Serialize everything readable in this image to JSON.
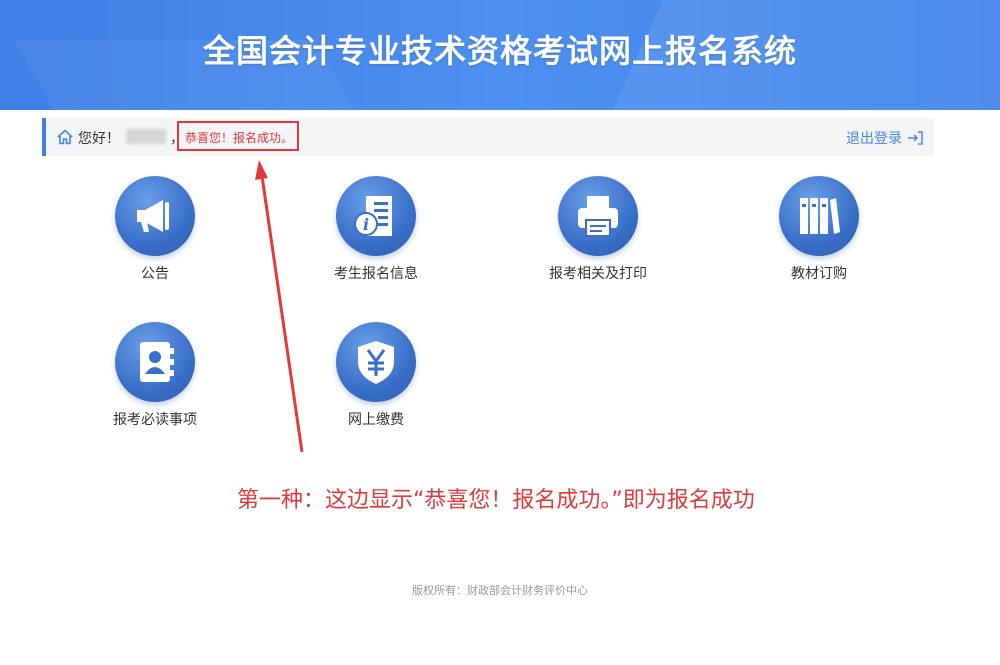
{
  "header": {
    "title": "全国会计专业技术资格考试网上报名系统"
  },
  "welcome_bar": {
    "greeting": "您好！",
    "separator": "，",
    "success_message": "恭喜您！报名成功。",
    "logout_label": "退出登录"
  },
  "tiles": [
    {
      "label": "公告",
      "icon": "megaphone-icon"
    },
    {
      "label": "考生报名信息",
      "icon": "info-document-icon"
    },
    {
      "label": "报考相关及打印",
      "icon": "printer-icon"
    },
    {
      "label": "教材订购",
      "icon": "books-icon"
    },
    {
      "label": "报考必读事项",
      "icon": "contact-book-icon"
    },
    {
      "label": "网上缴费",
      "icon": "yen-shield-icon"
    }
  ],
  "annotation": "第一种：这边显示“恭喜您！报名成功。”即为报名成功",
  "footer": "版权所有：财政部会计财务评价中心",
  "colors": {
    "brand_blue": "#3f7fe6",
    "highlight_red": "#e23a3a",
    "link_blue": "#4a86e8"
  }
}
